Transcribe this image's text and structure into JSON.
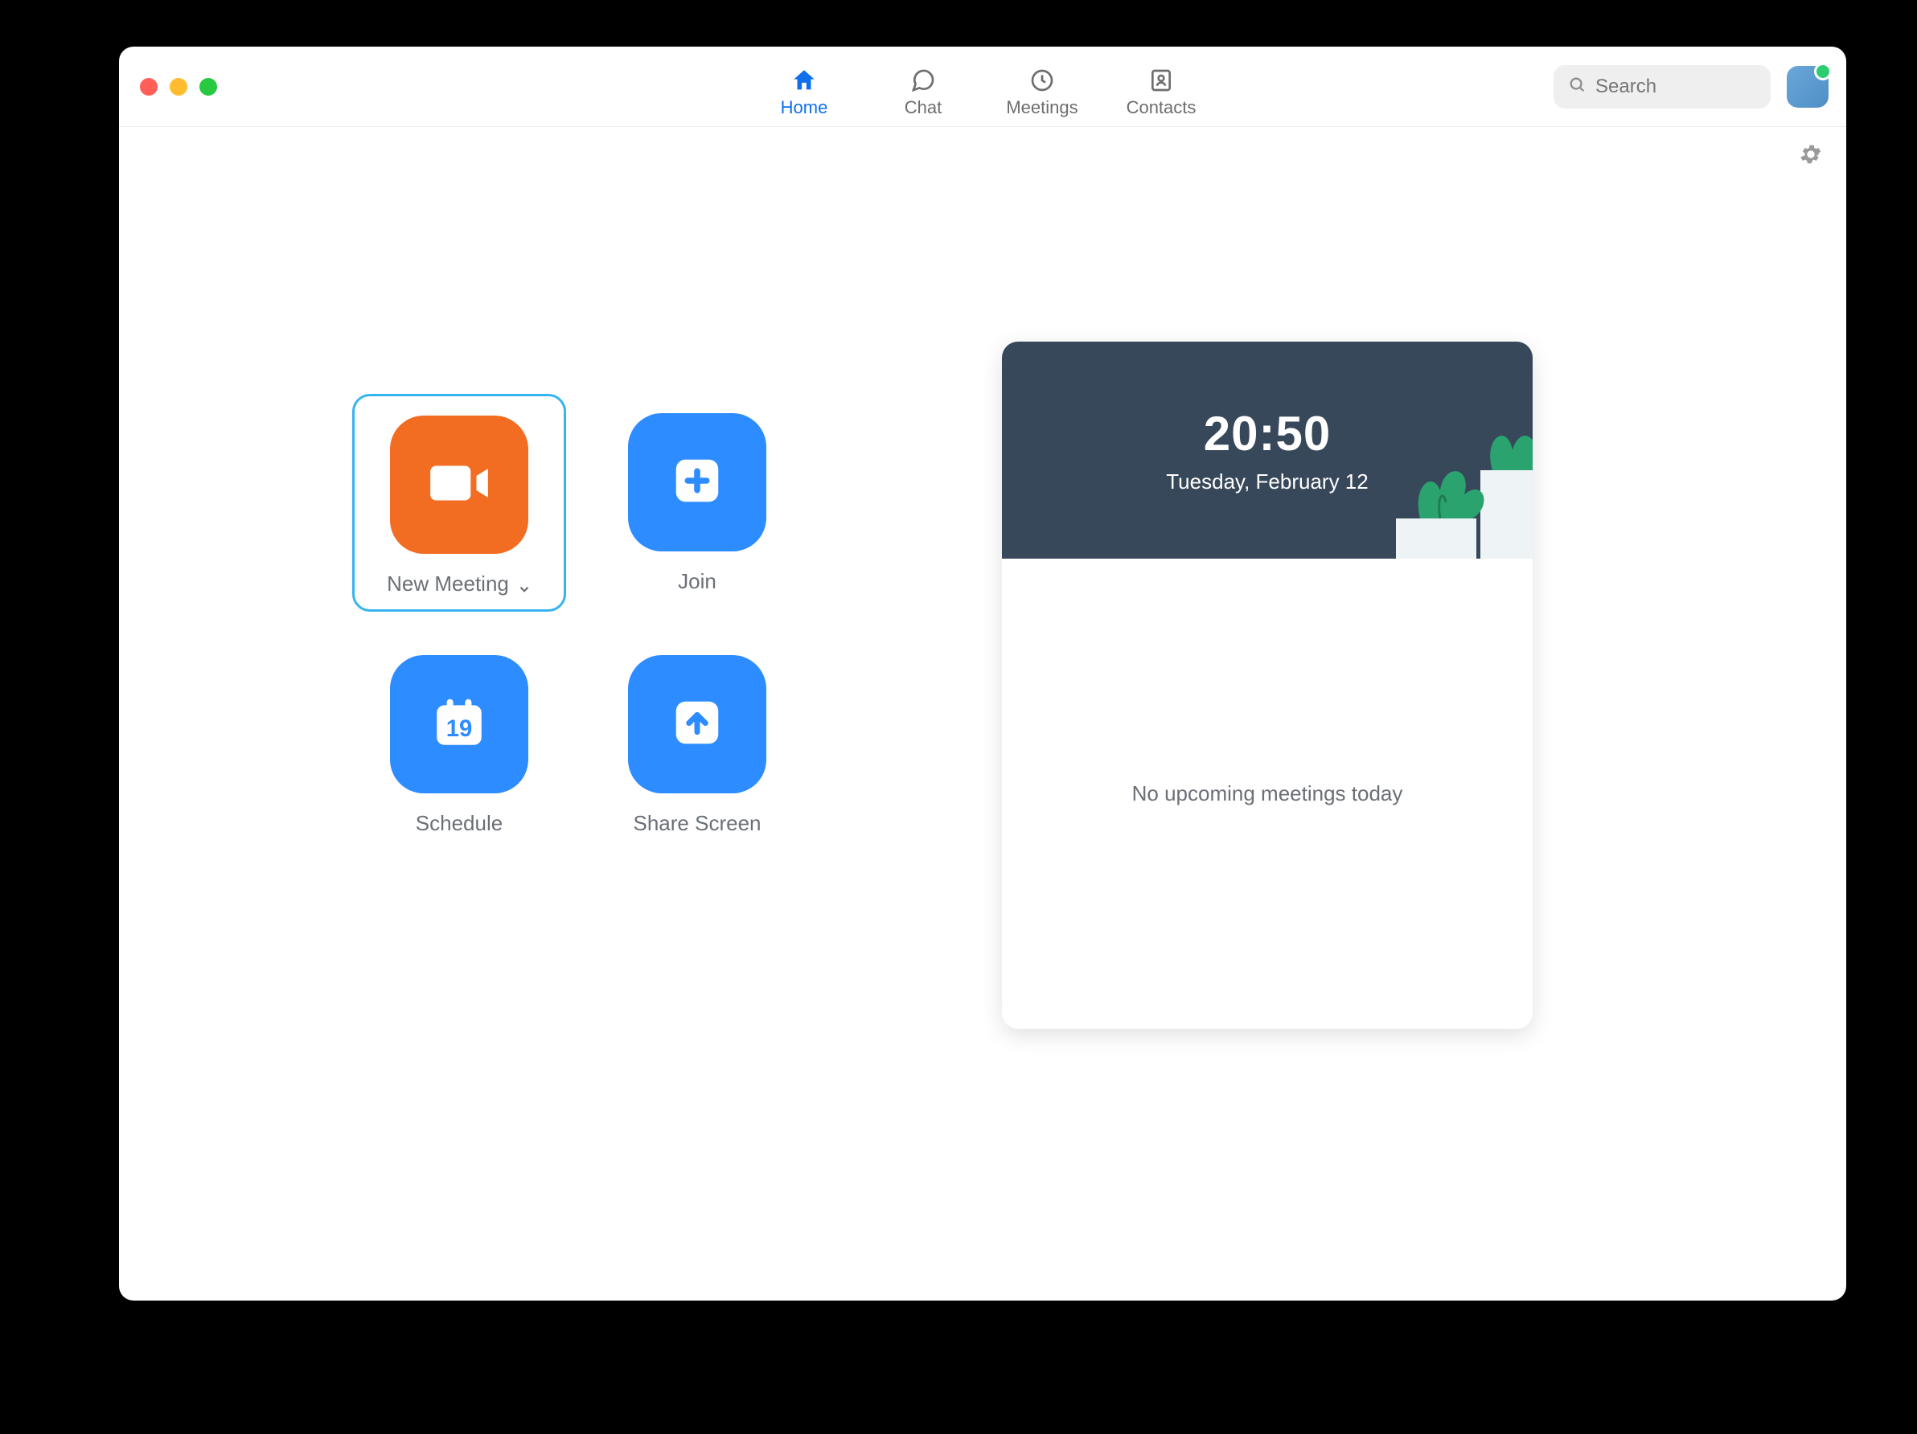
{
  "nav": {
    "tabs": [
      {
        "label": "Home",
        "active": true
      },
      {
        "label": "Chat",
        "active": false
      },
      {
        "label": "Meetings",
        "active": false
      },
      {
        "label": "Contacts",
        "active": false
      }
    ]
  },
  "search": {
    "placeholder": "Search"
  },
  "actions": {
    "new_meeting": "New Meeting",
    "join": "Join",
    "schedule": "Schedule",
    "share_screen": "Share Screen",
    "calendar_day": "19"
  },
  "clock": {
    "time": "20:50",
    "date": "Tuesday, February 12"
  },
  "schedule_panel": {
    "empty_message": "No upcoming meetings today"
  }
}
